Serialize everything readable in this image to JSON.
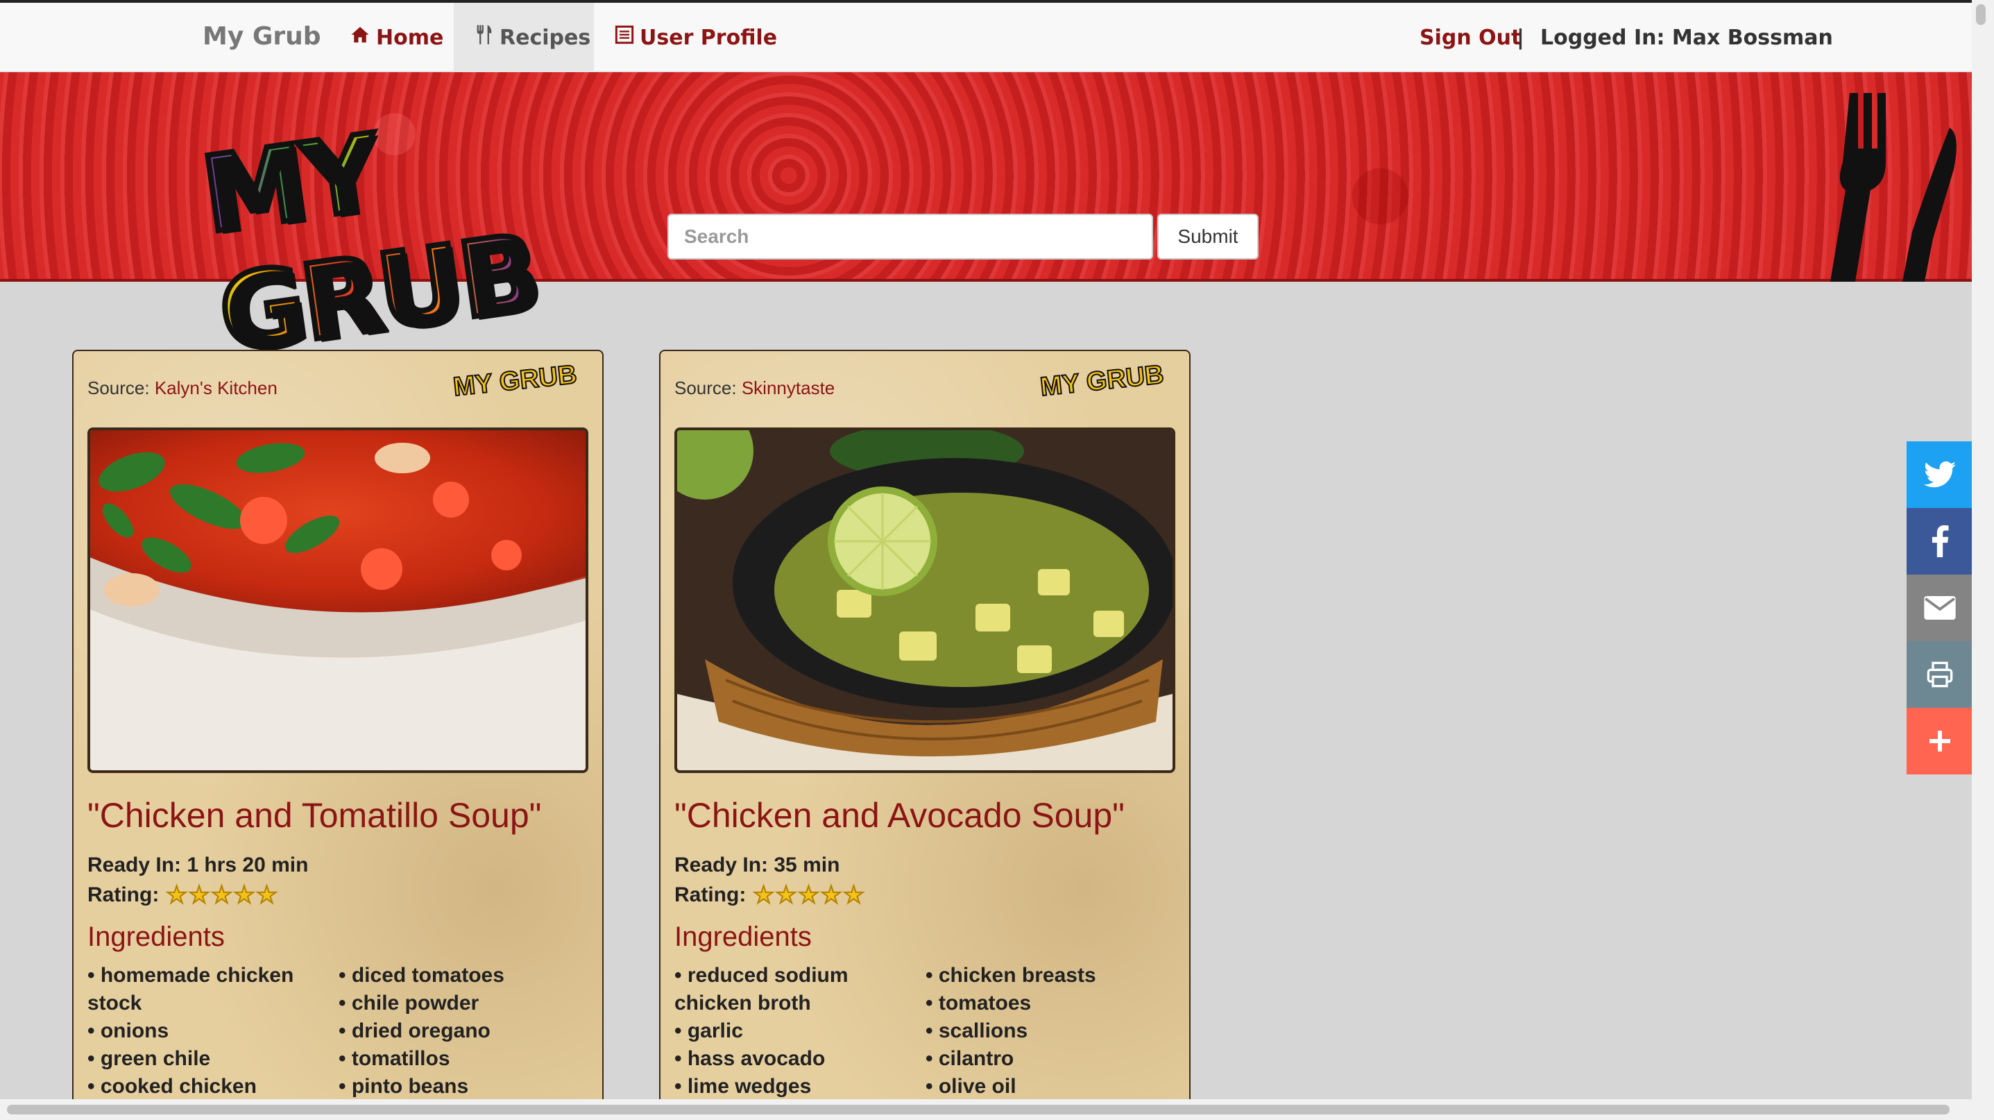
{
  "nav": {
    "brand": "My Grub",
    "home": "Home",
    "recipes": "Recipes",
    "profile": "User Profile",
    "sign_out": "Sign Out",
    "separator": "|",
    "logged_in": "Logged In: Max Bossman"
  },
  "banner": {
    "logo_text": "MY GRUB",
    "search_placeholder": "Search",
    "submit_label": "Submit"
  },
  "cards": [
    {
      "source_label": "Source:",
      "source": "Kalyn's Kitchen",
      "mini_logo": "MY GRUB",
      "title": "\"Chicken and Tomatillo Soup\"",
      "ready_in": "Ready In: 1 hrs 20 min",
      "rating_label": "Rating:",
      "rating_stars": 5,
      "ingredients_title": "Ingredients",
      "ingredients_left": [
        "homemade chicken stock",
        "onions",
        "green chile",
        "cooked chicken"
      ],
      "ingredients_right": [
        "diced tomatoes",
        "chile powder",
        "dried oregano",
        "tomatillos",
        "pinto beans"
      ]
    },
    {
      "source_label": "Source:",
      "source": "Skinnytaste",
      "mini_logo": "MY GRUB",
      "title": "\"Chicken and Avocado Soup\"",
      "ready_in": "Ready In: 35 min",
      "rating_label": "Rating:",
      "rating_stars": 5,
      "ingredients_title": "Ingredients",
      "ingredients_left": [
        "reduced sodium chicken broth",
        "garlic",
        "hass avocado",
        "lime wedges"
      ],
      "ingredients_right": [
        "chicken breasts",
        "tomatoes",
        "scallions",
        "cilantro",
        "olive oil"
      ]
    }
  ],
  "social": [
    "twitter-icon",
    "facebook-icon",
    "email-icon",
    "print-icon",
    "plus-icon"
  ],
  "stars_glyph": "★★★★★"
}
